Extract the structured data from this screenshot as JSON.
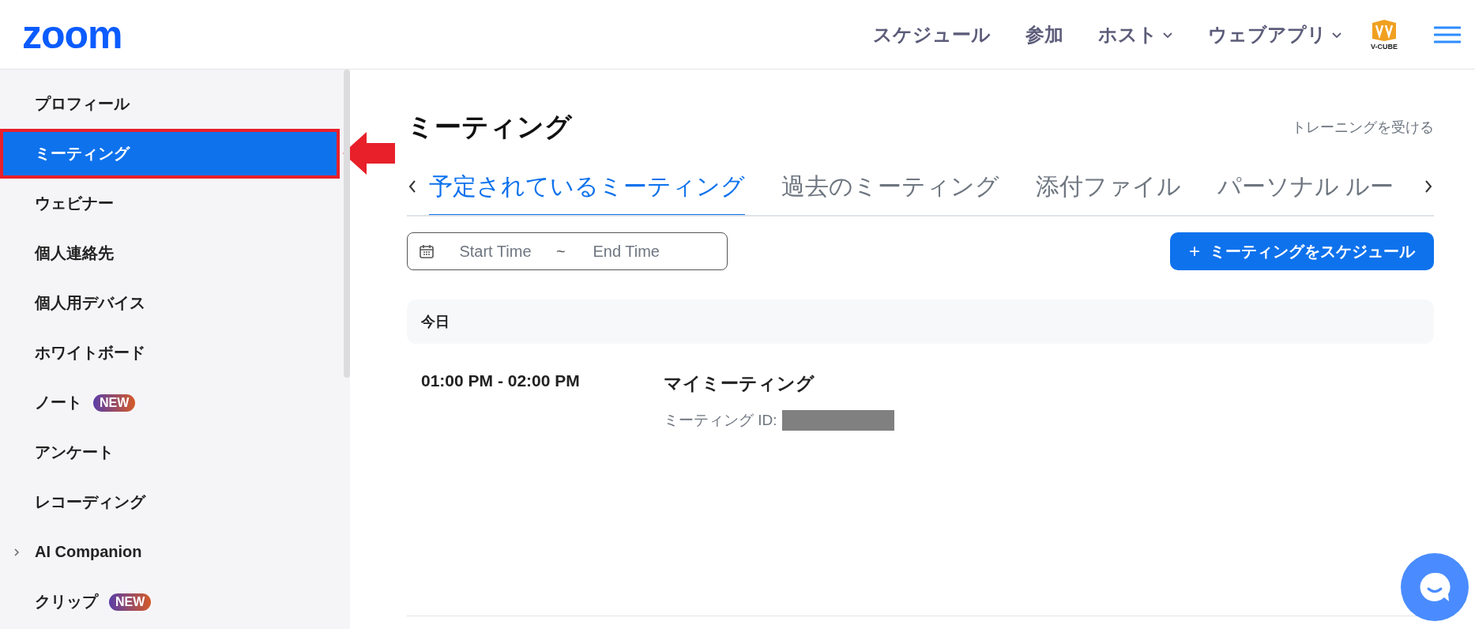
{
  "header": {
    "logo": "zoom",
    "nav": [
      {
        "label": "スケジュール",
        "dropdown": false
      },
      {
        "label": "参加",
        "dropdown": false
      },
      {
        "label": "ホスト",
        "dropdown": true
      },
      {
        "label": "ウェブアプリ",
        "dropdown": true
      }
    ],
    "partner_logo": "V-CUBE"
  },
  "sidebar": {
    "items": [
      {
        "label": "プロフィール",
        "selected": false,
        "highlighted": false
      },
      {
        "label": "ミーティング",
        "selected": true,
        "highlighted": true
      },
      {
        "label": "ウェビナー",
        "selected": false,
        "highlighted": false
      },
      {
        "label": "個人連絡先",
        "selected": false,
        "highlighted": false
      },
      {
        "label": "個人用デバイス",
        "selected": false,
        "highlighted": false
      },
      {
        "label": "ホワイトボード",
        "selected": false,
        "highlighted": false
      },
      {
        "label": "ノート",
        "selected": false,
        "highlighted": false,
        "badge": "NEW"
      },
      {
        "label": "アンケート",
        "selected": false,
        "highlighted": false
      },
      {
        "label": "レコーディング",
        "selected": false,
        "highlighted": false
      },
      {
        "label": "AI Companion",
        "selected": false,
        "highlighted": false,
        "expandable": true
      },
      {
        "label": "クリップ",
        "selected": false,
        "highlighted": false,
        "badge": "NEW"
      }
    ]
  },
  "page": {
    "title": "ミーティング",
    "training_link": "トレーニングを受ける",
    "tabs": [
      {
        "label": "予定されているミーティング",
        "selected": true
      },
      {
        "label": "過去のミーティング",
        "selected": false
      },
      {
        "label": "添付ファイル",
        "selected": false
      },
      {
        "label": "パーソナル ルー",
        "selected": false
      }
    ],
    "date_range": {
      "start_placeholder": "Start Time",
      "separator": "~",
      "end_placeholder": "End Time"
    },
    "schedule_button": {
      "icon": "+",
      "label": "ミーティングをスケジュール"
    },
    "day_heading": "今日",
    "meetings": [
      {
        "time": "01:00 PM - 02:00 PM",
        "title": "マイミーティング",
        "id_label": "ミーティング ID:",
        "id_redacted": true
      }
    ]
  }
}
